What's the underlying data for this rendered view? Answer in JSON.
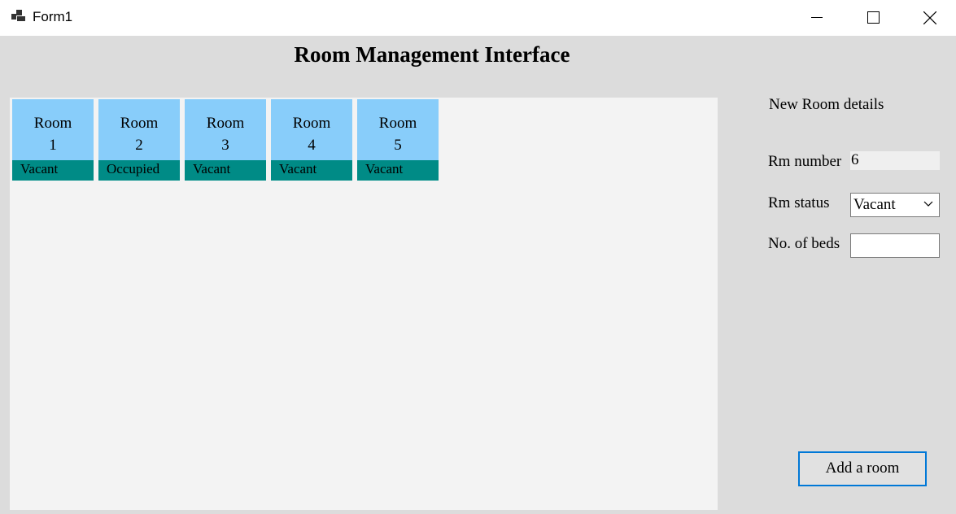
{
  "window": {
    "title": "Form1"
  },
  "header": {
    "title": "Room Management Interface"
  },
  "rooms": [
    {
      "label": "Room",
      "number": "1",
      "status": "Vacant"
    },
    {
      "label": "Room",
      "number": "2",
      "status": "Occupied"
    },
    {
      "label": "Room",
      "number": "3",
      "status": "Vacant"
    },
    {
      "label": "Room",
      "number": "4",
      "status": "Vacant"
    },
    {
      "label": "Room",
      "number": "5",
      "status": "Vacant"
    }
  ],
  "form": {
    "heading": "New Room details",
    "rm_number_label": "Rm number",
    "rm_number_value": "6",
    "rm_status_label": "Rm status",
    "rm_status_value": "Vacant",
    "beds_label": "No. of beds",
    "beds_value": "",
    "add_button": "Add a room"
  },
  "colors": {
    "room_card": "#88cdfa",
    "room_status_bar": "#008b86",
    "panel": "#f3f3f3",
    "background": "#dcdcdc",
    "button_border": "#0078d7"
  },
  "icons": {
    "app": "app-window-icon",
    "minimize": "minimize-icon",
    "maximize": "maximize-icon",
    "close": "close-icon",
    "dropdown": "chevron-down-icon"
  }
}
